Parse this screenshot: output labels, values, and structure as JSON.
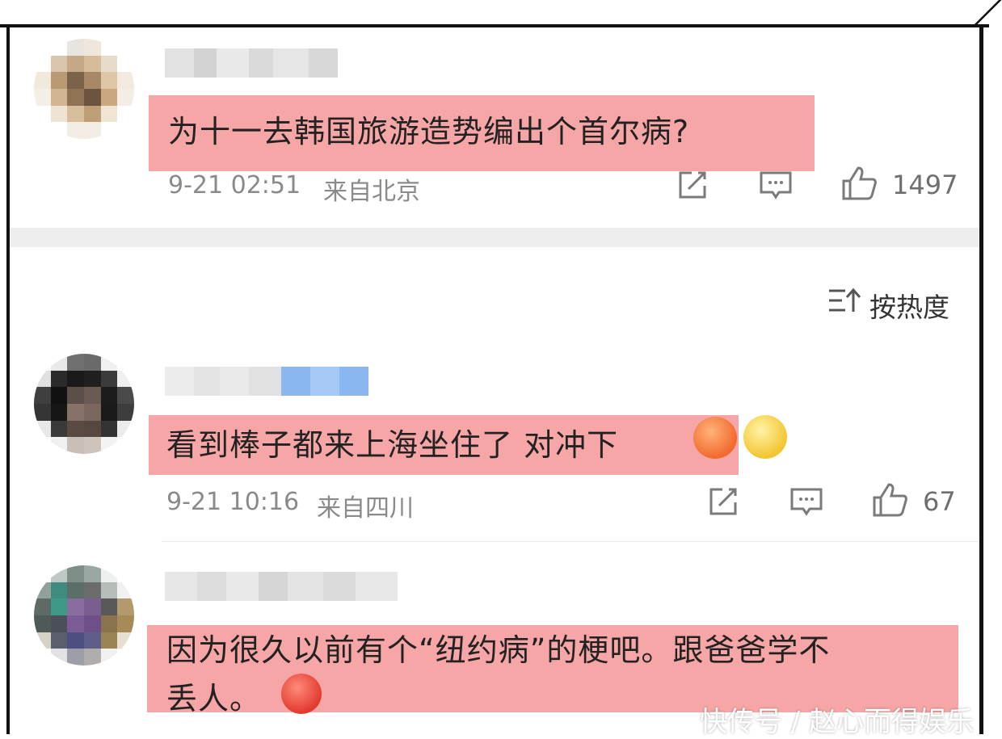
{
  "colors": {
    "highlight": "#f59a9a",
    "text": "#222222",
    "meta": "#8a8a8a",
    "icon": "#7a7a7a",
    "divider": "#eeeeef"
  },
  "sort": {
    "icon": "sort-icon",
    "label": "按热度"
  },
  "comments": [
    {
      "text": "为十一去韩国旅游造势编出个首尔病?",
      "time": "9-21 02:51",
      "location": "来自北京",
      "likes": "1497"
    },
    {
      "text": "看到棒子都来上海坐住了 对冲下",
      "time": "9-21 10:16",
      "location": "来自四川",
      "likes": "67"
    },
    {
      "text_line1": "因为很久以前有个“纽约病”的梗吧。跟爸爸学不",
      "text_line2": "丢人。"
    }
  ],
  "watermark": "快传号 / 赵心而得娱乐"
}
